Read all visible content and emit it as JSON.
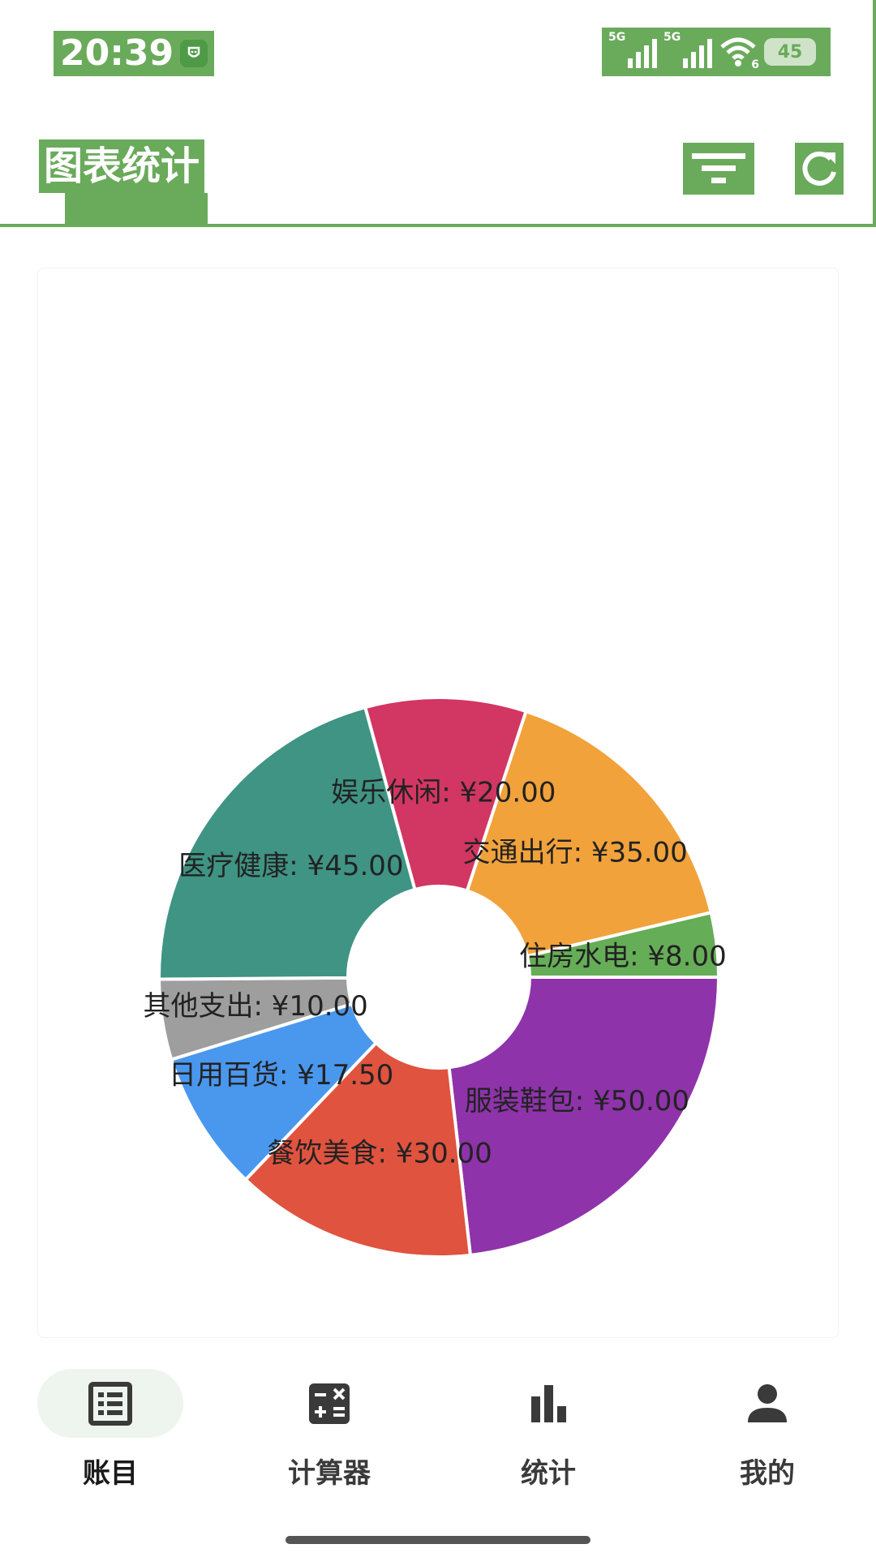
{
  "status_bar": {
    "time": "20:39",
    "signal_1_label": "5G",
    "signal_2_label": "5G",
    "wifi_label": "6",
    "battery": "45",
    "icons": [
      "shield-icon",
      "signal-icon",
      "signal-icon",
      "wifi-icon",
      "battery-icon"
    ]
  },
  "header": {
    "title": "图表统计",
    "actions": [
      "filter-icon",
      "refresh-icon"
    ],
    "accent_color": "#6aaa5b"
  },
  "chart_data": {
    "type": "pie",
    "donut": true,
    "categories": [
      "服装鞋包",
      "餐饮美食",
      "日用百货",
      "其他支出",
      "医疗健康",
      "娱乐休闲",
      "交通出行",
      "住房水电"
    ],
    "values": [
      50.0,
      30.0,
      17.5,
      10.0,
      45.0,
      20.0,
      35.0,
      8.0
    ],
    "labels": [
      "服装鞋包: ¥50.00",
      "餐饮美食: ¥30.00",
      "日用百货: ¥17.50",
      "其他支出: ¥10.00",
      "医疗健康: ¥45.00",
      "娱乐休闲: ¥20.00",
      "交通出行: ¥35.00",
      "住房水电: ¥8.00"
    ],
    "colors": [
      "#8e33aa",
      "#e0533f",
      "#4a97ee",
      "#9e9e9e",
      "#3f9484",
      "#d23662",
      "#f1a23b",
      "#66ad57"
    ],
    "start_angle_deg": 0,
    "direction": "clockwise"
  },
  "bottom_nav": {
    "items": [
      {
        "label": "账目",
        "icon": "ledger-icon",
        "active": true
      },
      {
        "label": "计算器",
        "icon": "calculator-icon",
        "active": false
      },
      {
        "label": "统计",
        "icon": "bar-chart-icon",
        "active": false
      },
      {
        "label": "我的",
        "icon": "person-icon",
        "active": false
      }
    ]
  }
}
